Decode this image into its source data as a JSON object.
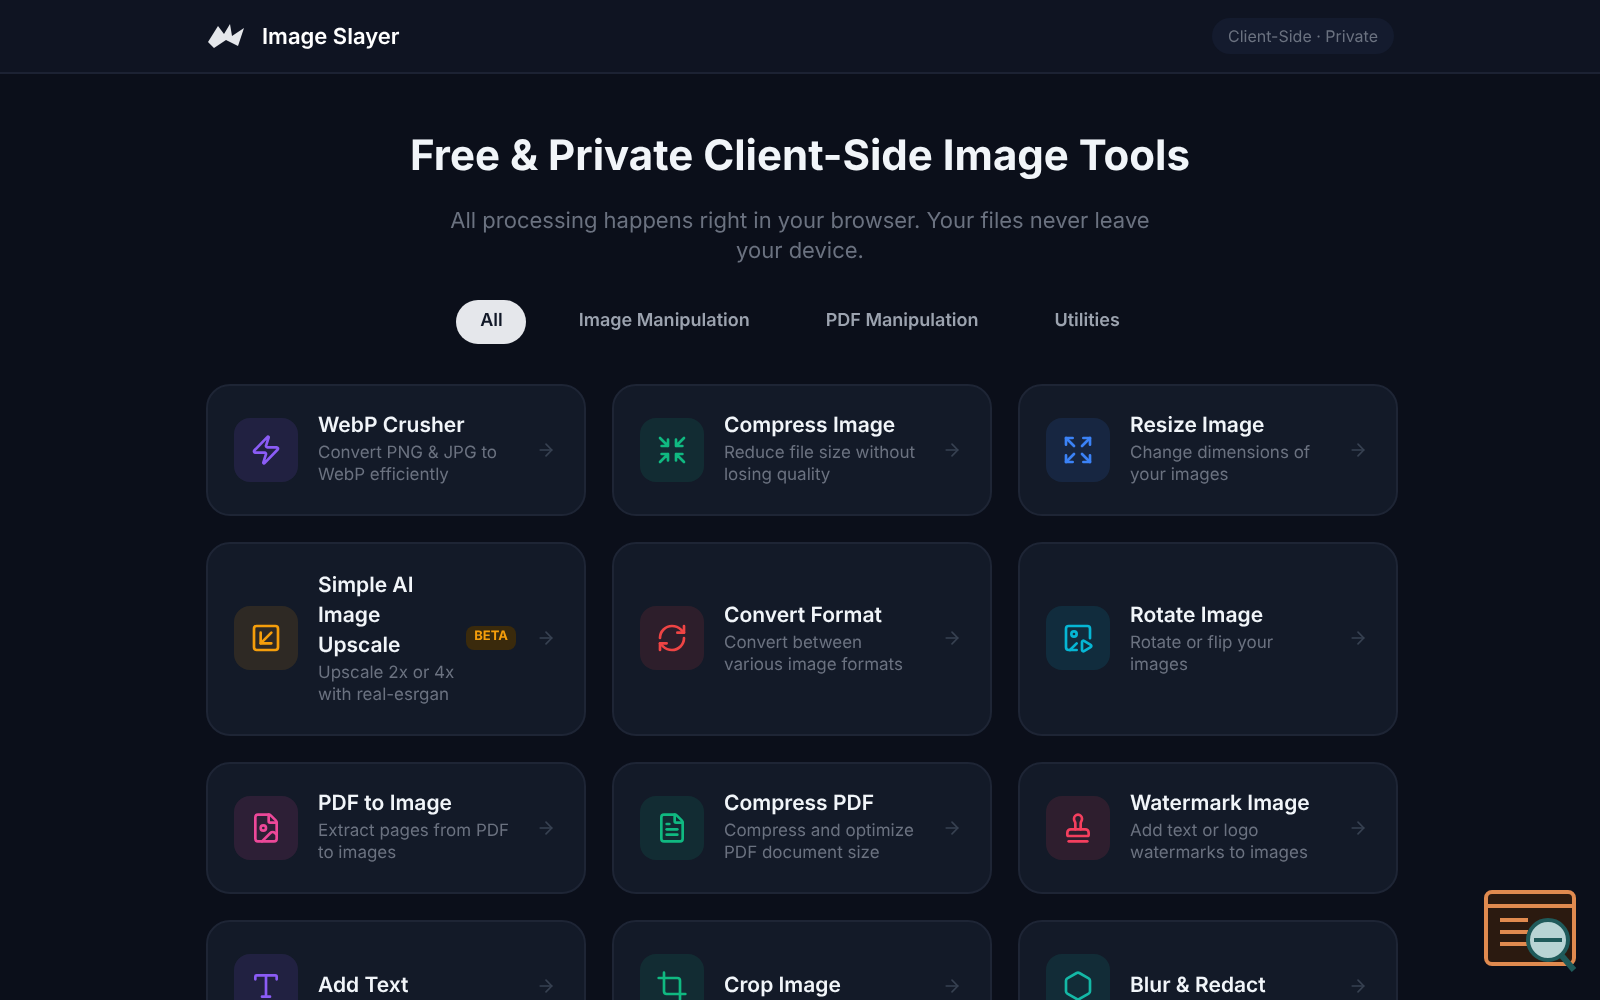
{
  "header": {
    "brand": "Image Slayer",
    "pill": "Client-Side · Private"
  },
  "hero": {
    "title": "Free & Private Client-Side Image Tools",
    "subtitle": "All processing happens right in your browser. Your files never leave your device."
  },
  "tabs": [
    {
      "label": "All",
      "selected": true
    },
    {
      "label": "Image Manipulation",
      "selected": false
    },
    {
      "label": "PDF Manipulation",
      "selected": false
    },
    {
      "label": "Utilities",
      "selected": false
    }
  ],
  "tools": [
    {
      "title": "WebP Crusher",
      "description": "Convert PNG & JPG to WebP efficiently",
      "color": "#8b5cf6"
    },
    {
      "title": "Compress Image",
      "description": "Reduce file size without losing quality",
      "color": "#10b981"
    },
    {
      "title": "Resize Image",
      "description": "Change dimensions of your images",
      "color": "#3b82f6"
    },
    {
      "title": "Simple AI Image Upscale",
      "description": "Upscale 2x or 4x with real-esrgan",
      "color": "#f59e0b",
      "badge": "BETA"
    },
    {
      "title": "Convert Format",
      "description": "Convert between various image formats",
      "color": "#ef4444"
    },
    {
      "title": "Rotate Image",
      "description": "Rotate or flip your images",
      "color": "#06b6d4"
    },
    {
      "title": "PDF to Image",
      "description": "Extract pages from PDF to images",
      "color": "#ec4899"
    },
    {
      "title": "Compress PDF",
      "description": "Compress and optimize PDF document size",
      "color": "#10b981"
    },
    {
      "title": "Watermark Image",
      "description": "Add text or logo watermarks to images",
      "color": "#f43f5e"
    },
    {
      "title": "Add Text",
      "color": "#8b5cf6"
    },
    {
      "title": "Crop Image",
      "color": "#10b981"
    },
    {
      "title": "Blur & Redact",
      "color": "#14b8a6"
    }
  ]
}
